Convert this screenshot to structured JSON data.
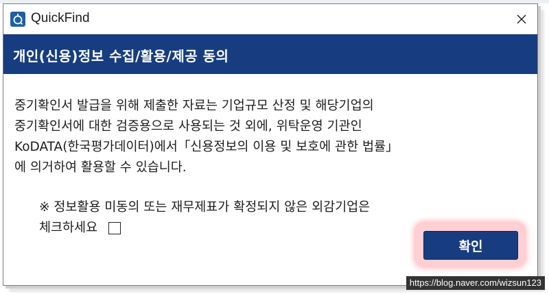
{
  "window": {
    "app_title": "QuickFind",
    "icon": "search-app-icon",
    "close_glyph": "✕"
  },
  "header": {
    "title": "개인(신용)정보 수집/활용/제공 동의"
  },
  "body": {
    "lines": [
      "중기확인서 발급을 위해 제출한 자료는 기업규모 산정 및 해당기업의",
      "중기확인서에 대한 검증용으로 사용되는 것 외에, 위탁운영 기관인",
      "KoDATA(한국평가데이터)에서「신용정보의 이용 및 보호에 관한 법률」",
      "에 의거하여 활용할 수 있습니다."
    ]
  },
  "notice": {
    "line1": "※ 정보활용 미동의 또는 재무제표가 확정되지 않은 외감기업은",
    "line2": "체크하세요",
    "checkbox_checked": false
  },
  "buttons": {
    "confirm_label": "확인"
  },
  "watermark": "https://blog.naver.com/wizsun123",
  "colors": {
    "brand_navy": "#173d80",
    "highlight": "#ff6e78"
  }
}
